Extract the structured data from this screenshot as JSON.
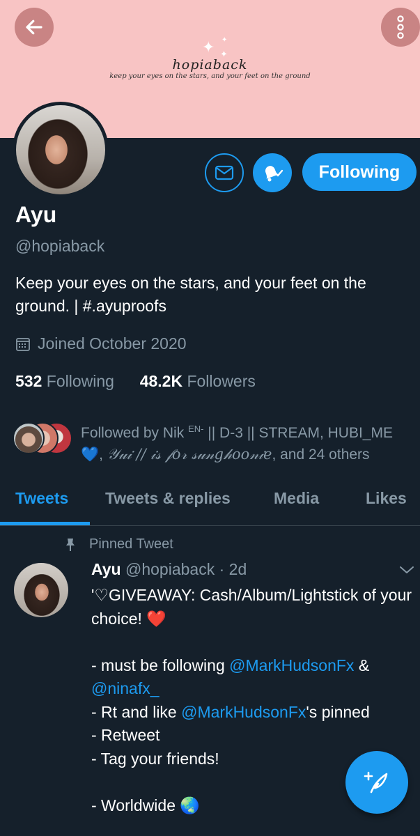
{
  "banner": {
    "title": "hopiaback",
    "subtitle": "keep your eyes on the stars, and your feet on the ground"
  },
  "icons": {
    "back": "arrow-left-icon",
    "more": "more-vertical-icon",
    "message": "envelope-icon",
    "notify": "bell-check-icon",
    "calendar": "calendar-icon",
    "pin": "pin-icon",
    "caret": "chevron-down-icon",
    "compose": "feather-plus-icon"
  },
  "profile": {
    "follow_button": "Following",
    "name": "Ayu",
    "handle": "@hopiaback",
    "bio": "Keep your eyes on the stars, and your feet on the ground. | #.ayuproofs",
    "joined": "Joined October 2020",
    "following_count": "532",
    "following_label": "Following",
    "followers_count": "48.2K",
    "followers_label": "Followers"
  },
  "followed_by": {
    "prefix": "Followed by Nik ",
    "sup": "EN-",
    "rest": " || D-3 || STREAM, HUBI_ME",
    "heart": "💙",
    "second_name": "𝒴𝓊𝒾 // 𝒾𝓈 𝒻𝑜𝓇 𝓈𝓊𝓃𝑔𝒽𝑜𝑜𝓃𝒾𝑒",
    "suffix": ", and 24 others"
  },
  "tabs": [
    "Tweets",
    "Tweets & replies",
    "Media",
    "Likes"
  ],
  "tweet": {
    "pinned_label": "Pinned Tweet",
    "name": "Ayu",
    "handle": "@hopiaback",
    "time": "· 2d",
    "line1": "'♡GIVEAWAY: Cash/Album/Lightstick of your choice! ",
    "heart": "❤️",
    "l2a": "- must be following ",
    "mention1": "@MarkHudsonFx",
    "l2b": " & ",
    "mention2": "@ninafx_",
    "l3a": "- Rt and like ",
    "mention3": "@MarkHudsonFx",
    "l3b": "'s pinned",
    "l4": "- Retweet",
    "l5": "- Tag your friends!",
    "l6": "- Worldwide ",
    "globe": "🌏"
  },
  "colors": {
    "background": "#15202b",
    "accent": "#1d9bf0",
    "banner": "#f8c4c4",
    "muted": "#8899a6"
  }
}
